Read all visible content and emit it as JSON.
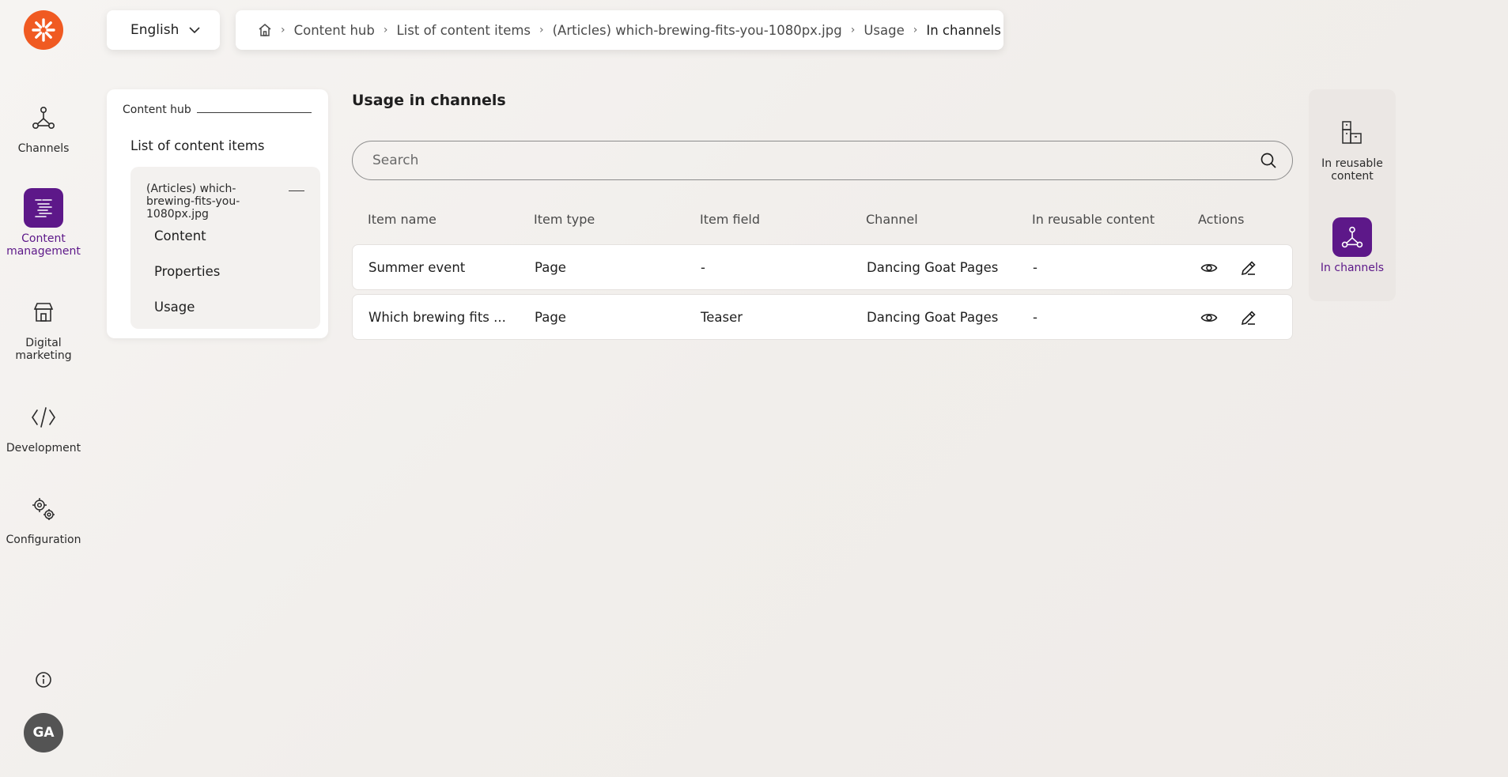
{
  "nav": {
    "items": [
      {
        "label": "Channels",
        "icon": "channels-icon"
      },
      {
        "label": "Content management",
        "icon": "content-management-icon",
        "active": true
      },
      {
        "label": "Digital marketing",
        "icon": "store-icon"
      },
      {
        "label": "Development",
        "icon": "code-icon"
      },
      {
        "label": "Configuration",
        "icon": "gears-icon"
      }
    ],
    "avatar_initials": "GA"
  },
  "language": {
    "selected": "English"
  },
  "breadcrumbs": {
    "items": [
      "Content hub",
      "List of content items",
      "(Articles) which-brewing-fits-you-1080px.jpg",
      "Usage"
    ],
    "current": "In channels"
  },
  "tree": {
    "hub": "Content hub",
    "list": "List of content items",
    "item": "(Articles) which-brewing-fits-you-1080px.jpg",
    "children": [
      "Content",
      "Properties",
      "Usage"
    ]
  },
  "main": {
    "heading": "Usage in channels",
    "search_placeholder": "Search",
    "columns": [
      "Item name",
      "Item type",
      "Item field",
      "Channel",
      "In reusable content",
      "Actions"
    ],
    "rows": [
      {
        "name": "Summer event",
        "type": "Page",
        "field": "-",
        "channel": "Dancing Goat Pages",
        "reusable": "-"
      },
      {
        "name": "Which brewing fits ...",
        "type": "Page",
        "field": "Teaser",
        "channel": "Dancing Goat Pages",
        "reusable": "-"
      }
    ]
  },
  "right_panel": {
    "items": [
      {
        "label": "In reusable content",
        "icon": "reusable-content-icon"
      },
      {
        "label": "In channels",
        "icon": "channels-icon",
        "active": true
      }
    ]
  },
  "colors": {
    "brand": "#f05a22",
    "accent": "#5d1889"
  }
}
